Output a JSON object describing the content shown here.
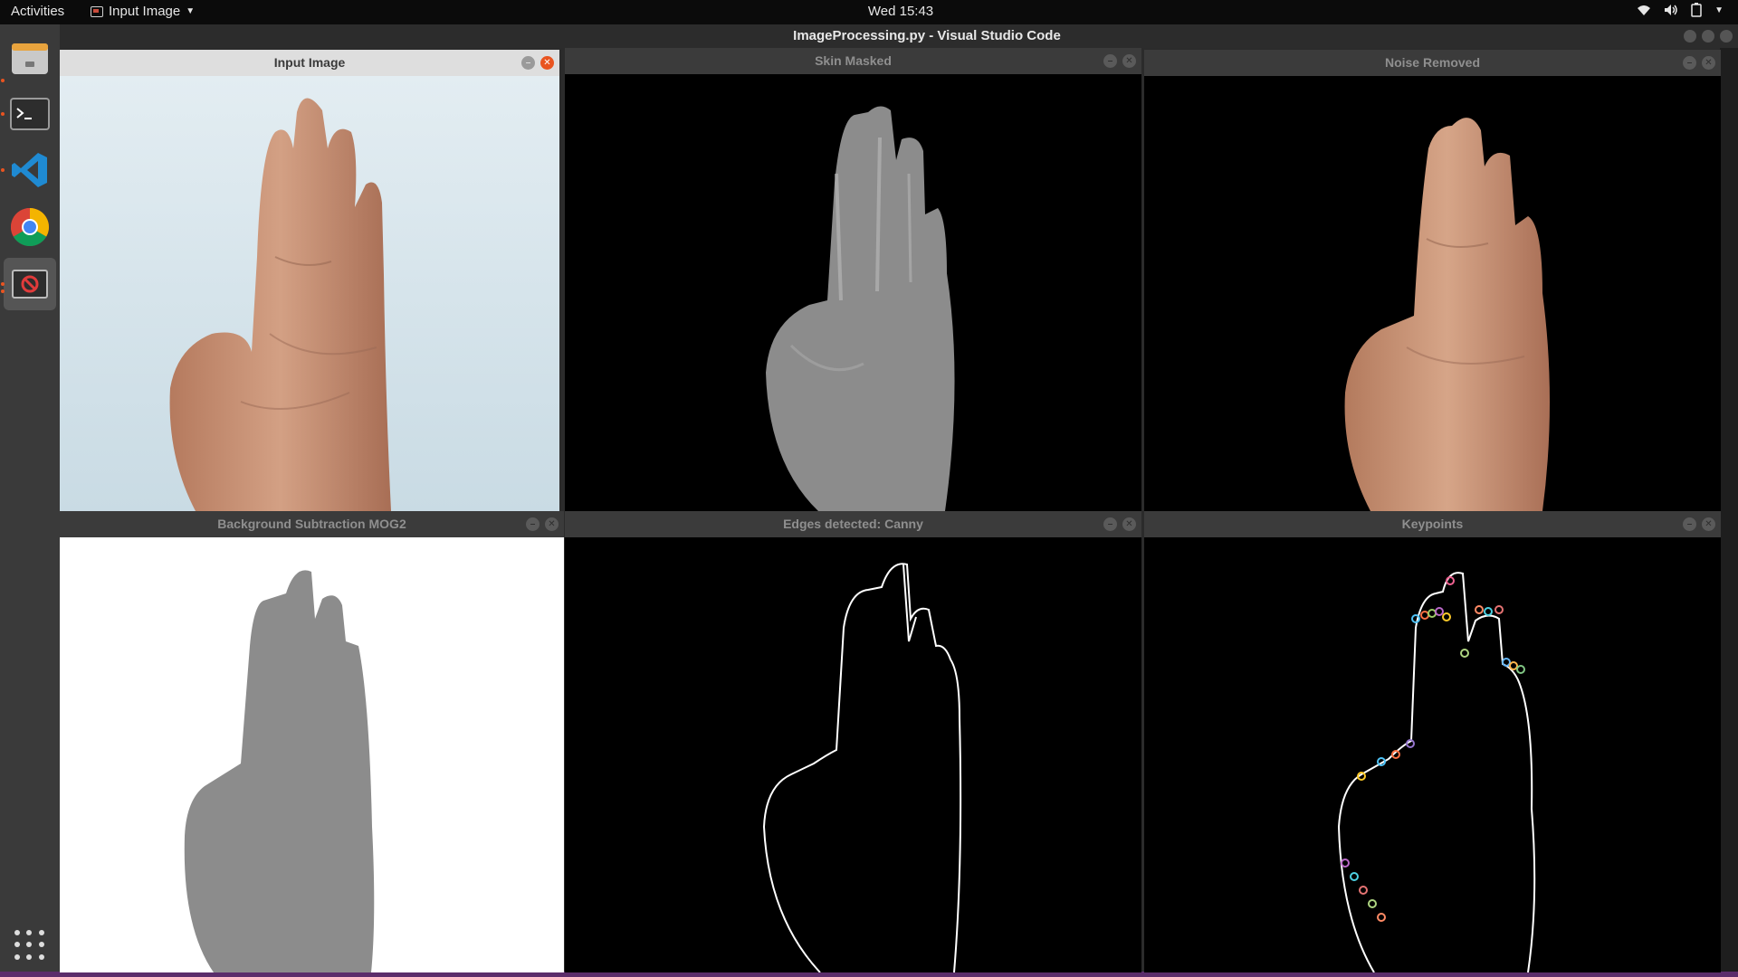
{
  "topbar": {
    "activities": "Activities",
    "app_menu": "Input Image",
    "clock": "Wed 15:43"
  },
  "vscode": {
    "title": "ImageProcessing.py - Visual Studio Code"
  },
  "dock": {
    "items": [
      "files-icon",
      "terminal-icon",
      "vscode-icon",
      "chrome-icon",
      "opencv-window-icon"
    ]
  },
  "windows": {
    "input": {
      "title": "Input Image"
    },
    "skin": {
      "title": "Skin Masked"
    },
    "noise": {
      "title": "Noise Removed"
    },
    "bg": {
      "title": "Background Subtraction MOG2"
    },
    "edges": {
      "title": "Edges detected: Canny"
    },
    "keypoints": {
      "title": "Keypoints"
    }
  },
  "colors": {
    "accent_close": "#e95420",
    "skin_tone": "#c79372",
    "mask_gray": "#8c8c8c",
    "input_bg": "#d9e6ee"
  }
}
